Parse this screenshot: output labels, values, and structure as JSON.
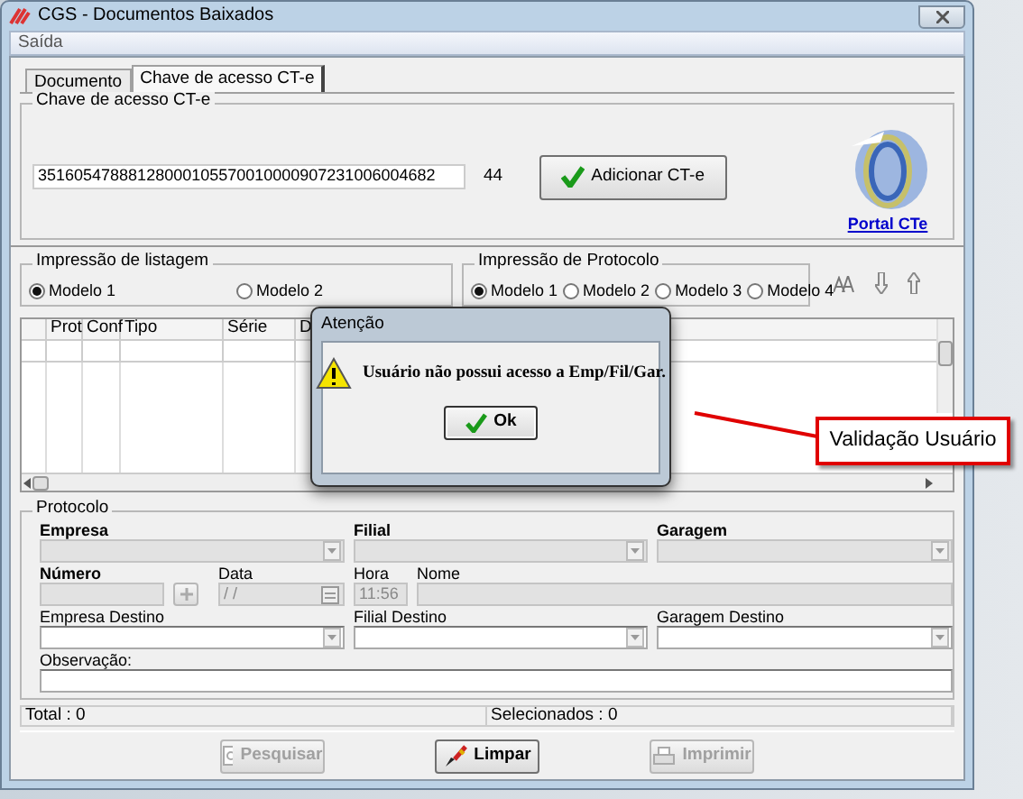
{
  "window": {
    "title": "CGS - Documentos Baixados"
  },
  "menu": [
    "Saída"
  ],
  "tabs": [
    {
      "label": "Documento",
      "selected": false
    },
    {
      "label": "Chave de acesso CT-e",
      "selected": true
    }
  ],
  "access_key": {
    "title": "Chave de acesso CT-e",
    "value": "35160547888128000105570010000907231006004682",
    "length": "44",
    "add_button": "Adicionar CT-e",
    "portal_link": "Portal CTe"
  },
  "listing_print": {
    "title": "Impressão de listagem",
    "options": [
      {
        "label": "Modelo 1",
        "selected": true
      },
      {
        "label": "Modelo 2",
        "selected": false
      }
    ]
  },
  "protocol_print": {
    "title": "Impressão de Protocolo",
    "options": [
      {
        "label": "Modelo 1",
        "selected": true
      },
      {
        "label": "Modelo 2",
        "selected": false
      },
      {
        "label": "Modelo 3",
        "selected": false
      },
      {
        "label": "Modelo 4",
        "selected": false
      }
    ]
  },
  "table": {
    "columns": [
      "Prot",
      "Conf",
      "Tipo",
      "Série",
      "D"
    ]
  },
  "protocol": {
    "title": "Protocolo",
    "fields": [
      {
        "label": "Empresa",
        "kind": "select",
        "bold": true,
        "disabled": true
      },
      {
        "label": "Filial",
        "kind": "select",
        "bold": true,
        "disabled": true
      },
      {
        "label": "Garagem",
        "kind": "select",
        "bold": true,
        "disabled": true
      },
      {
        "label": "Número",
        "kind": "lookup",
        "bold": true,
        "disabled": true
      },
      {
        "label": "Data",
        "kind": "date",
        "bold": false,
        "disabled": true,
        "value": " / /"
      },
      {
        "label": "Hora",
        "kind": "text",
        "bold": false,
        "disabled": true,
        "value": "11:56"
      },
      {
        "label": "Nome",
        "kind": "text",
        "bold": false,
        "disabled": true
      },
      {
        "label": "Empresa Destino",
        "kind": "select",
        "bold": false,
        "disabled": false
      },
      {
        "label": "Filial Destino",
        "kind": "select",
        "bold": false,
        "disabled": false
      },
      {
        "label": "Garagem Destino",
        "kind": "select",
        "bold": false,
        "disabled": false
      },
      {
        "label": "Observação:",
        "kind": "text",
        "bold": false,
        "disabled": false
      }
    ]
  },
  "status_bar": [
    "Total : 0",
    "Selecionados : 0"
  ],
  "buttons": [
    {
      "label": "Pesquisar",
      "kind": "search",
      "disabled": true
    },
    {
      "label": "Limpar",
      "kind": "clear",
      "disabled": false
    },
    {
      "label": "Imprimir",
      "kind": "print",
      "disabled": true
    }
  ],
  "dialog": {
    "title": "Atenção",
    "message": "Usuário não possui acesso a Emp/Fil/Gar.",
    "button": "Ok"
  },
  "callout": {
    "label": "Validação Usuário"
  }
}
